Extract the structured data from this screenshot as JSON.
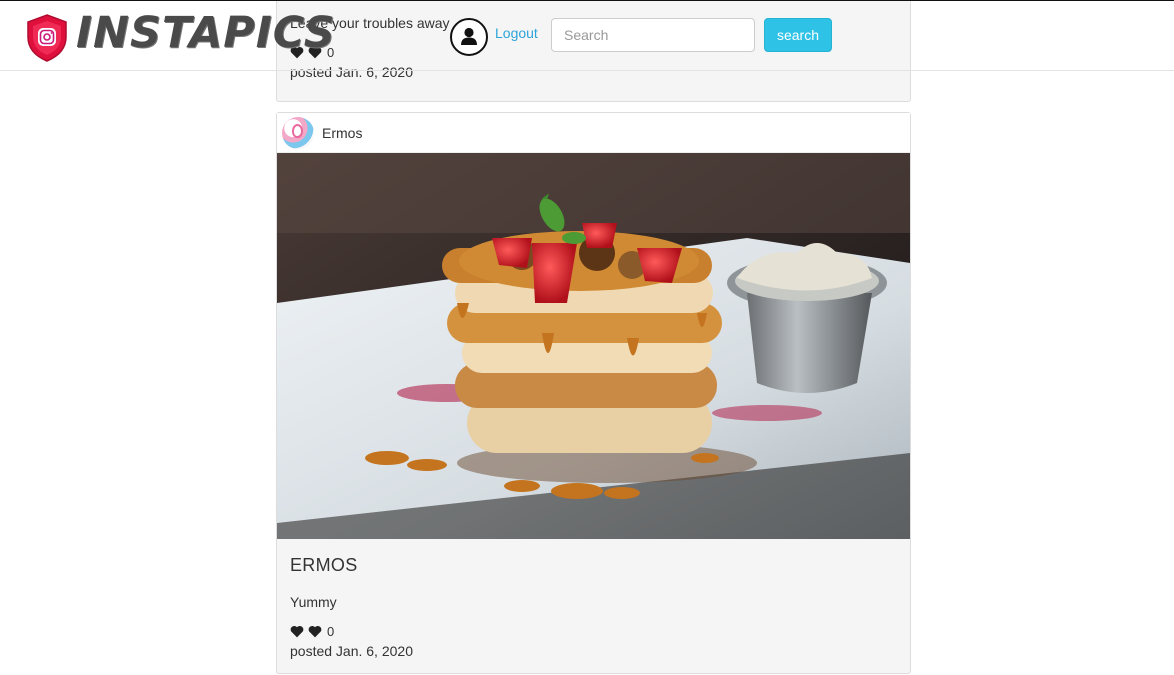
{
  "navbar": {
    "brand": "INSTAPICS",
    "logout_label": "Logout",
    "search_placeholder": "Search",
    "search_button": "search",
    "accent_color": "#2ec3e6",
    "link_color": "#2fa4d9"
  },
  "posts": [
    {
      "caption": "Leave your troubles away",
      "likes": "0",
      "posted": "posted Jan. 6, 2020"
    },
    {
      "username": "Ermos",
      "image": "pancake-stack-photo",
      "title": "ERMOS",
      "caption": "Yummy",
      "likes": "0",
      "posted": "posted Jan. 6, 2020"
    }
  ]
}
